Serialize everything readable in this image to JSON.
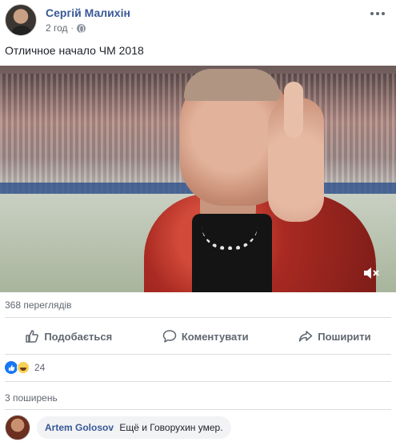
{
  "post": {
    "author": "Сергій Малихін",
    "time": "2 год",
    "dot": "·",
    "text": "Отличное начало ЧМ 2018",
    "views": "368 переглядів"
  },
  "actions": {
    "like": "Подобається",
    "comment": "Коментувати",
    "share": "Поширити"
  },
  "reactions": {
    "count": "24"
  },
  "shares": "3 поширень",
  "comment": {
    "name": "Artem Golosov",
    "text": "Ещё и Говорухин умер."
  },
  "icons": {
    "privacy": "globe-icon",
    "menu": "more-icon",
    "mute": "mute-icon"
  },
  "colors": {
    "link": "#385898",
    "like": "#1877f2",
    "muted": "#616770"
  }
}
